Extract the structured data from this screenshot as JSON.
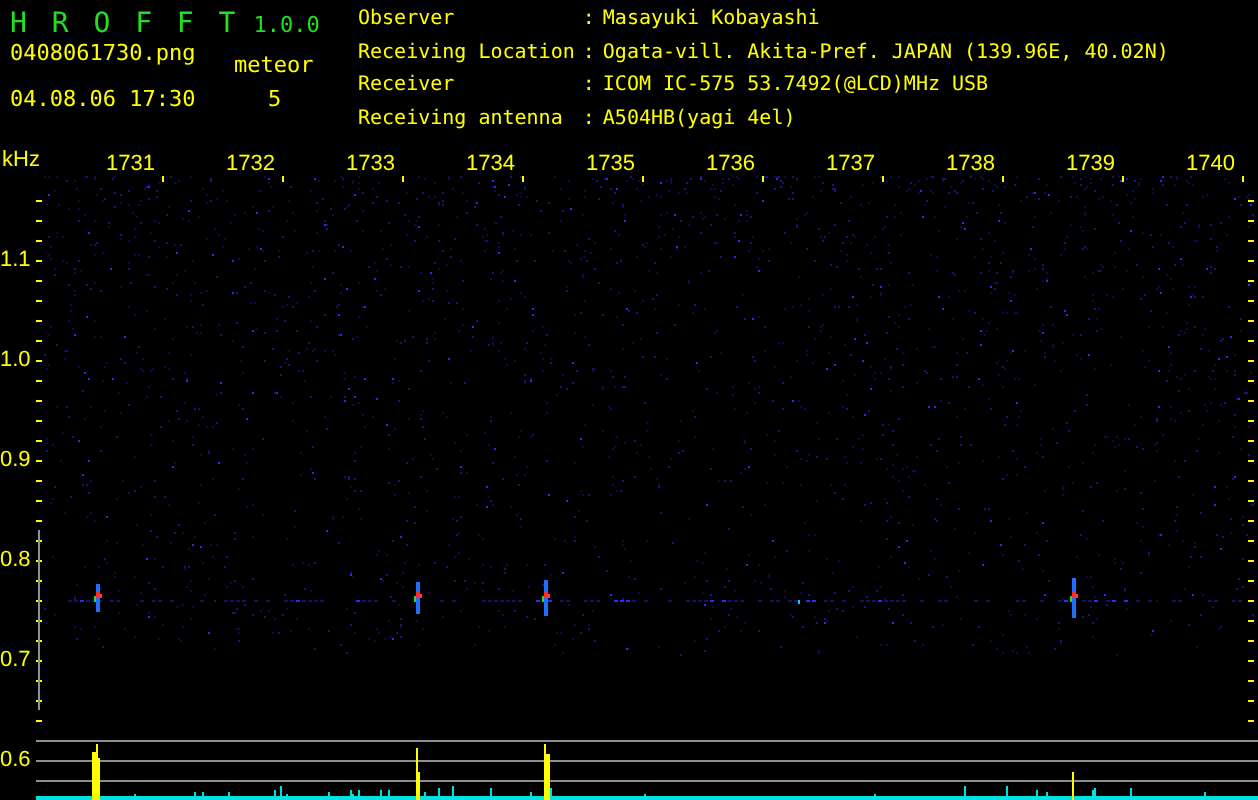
{
  "app": {
    "title": "H R O F F T",
    "version": "1.0.0"
  },
  "file": {
    "name": "0408061730.png",
    "timestamp": "04.08.06 17:30"
  },
  "meteor": {
    "label": "meteor",
    "count": "5"
  },
  "station_info": [
    {
      "label": "Observer",
      "separator": ":",
      "value": "Masayuki Kobayashi"
    },
    {
      "label": "Receiving Location",
      "separator": ":",
      "value": "Ogata-vill. Akita-Pref. JAPAN (139.96E, 40.02N)"
    },
    {
      "label": "Receiver",
      "separator": ":",
      "value": "ICOM IC-575 53.7492(@LCD)MHz USB"
    },
    {
      "label": "Receiving antenna",
      "separator": ":",
      "value": "A504HB(yagi 4el)"
    }
  ],
  "spectrogram": {
    "y_unit": "kHz",
    "x_labels": [
      "1731",
      "1732",
      "1733",
      "1734",
      "1735",
      "1736",
      "1737",
      "1738",
      "1739",
      "1740"
    ],
    "y_labels": [
      "1.1",
      "1.0",
      "0.9",
      "0.8",
      "0.7",
      "0.6"
    ]
  }
}
